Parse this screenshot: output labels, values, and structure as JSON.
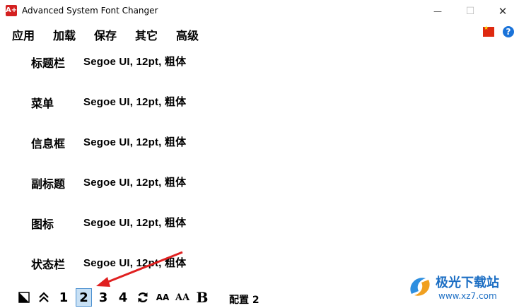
{
  "window": {
    "icon_text": "A+",
    "title": "Advanced System Font Changer",
    "minimize_glyph": "—",
    "maximize_glyph": "☐",
    "close_glyph": "✕"
  },
  "menu": {
    "items": [
      "应用",
      "加载",
      "保存",
      "其它",
      "高级"
    ]
  },
  "header_icons": [
    "china-flag-icon",
    "help-icon"
  ],
  "help_text": "?",
  "font_rows": [
    {
      "label": "标题栏",
      "value": "Segoe UI, 12pt, 粗体"
    },
    {
      "label": "菜单",
      "value": "Segoe UI, 12pt, 粗体"
    },
    {
      "label": "信息框",
      "value": "Segoe UI, 12pt, 粗体"
    },
    {
      "label": "副标题",
      "value": "Segoe UI, 12pt, 粗体"
    },
    {
      "label": "图标",
      "value": "Segoe UI, 12pt, 粗体"
    },
    {
      "label": "状态栏",
      "value": "Segoe UI, 12pt, 粗体"
    }
  ],
  "toolbar": {
    "profile_numbers": [
      "1",
      "2",
      "3",
      "4"
    ],
    "selected_profile": "2",
    "small_a_label": "AA",
    "medium_a_label": "AA",
    "bold_label": "B",
    "config_label": "配置 2"
  },
  "watermark": {
    "name": "极光下载站",
    "url": "www.xz7.com"
  },
  "colors": {
    "arrow": "#e02020",
    "selected_bg": "#c8e0f4",
    "watermark": "#1d6fc4"
  }
}
